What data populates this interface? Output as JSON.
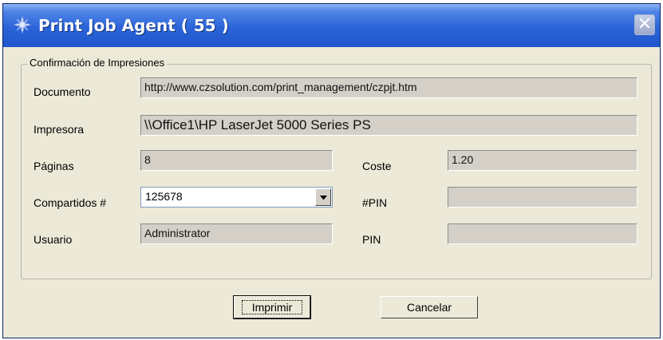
{
  "window": {
    "title": "Print Job Agent ( 55 )",
    "app_icon": "printer-agent-icon",
    "close_icon": "close-icon"
  },
  "group": {
    "title": "Confirmación de Impresiones"
  },
  "form": {
    "documento": {
      "label": "Documento",
      "value": "http://www.czsolution.com/print_management/czpjt.htm"
    },
    "impresora": {
      "label": "Impresora",
      "value": "\\\\Office1\\HP LaserJet 5000 Series PS"
    },
    "paginas": {
      "label": "Páginas",
      "value": "8"
    },
    "coste": {
      "label": "Coste",
      "value": "1.20"
    },
    "compartidos": {
      "label": "Compartidos #",
      "value": "125678"
    },
    "pin_hash": {
      "label": "#PIN",
      "value": ""
    },
    "usuario": {
      "label": "Usuario",
      "value": "Administrator"
    },
    "pin": {
      "label": "PIN",
      "value": ""
    }
  },
  "buttons": {
    "print": "Imprimir",
    "cancel": "Cancelar"
  },
  "colors": {
    "titlebar": "#2b64d8",
    "dialog_bg": "#ece9d8",
    "readonly_field": "#d4d0c8"
  }
}
